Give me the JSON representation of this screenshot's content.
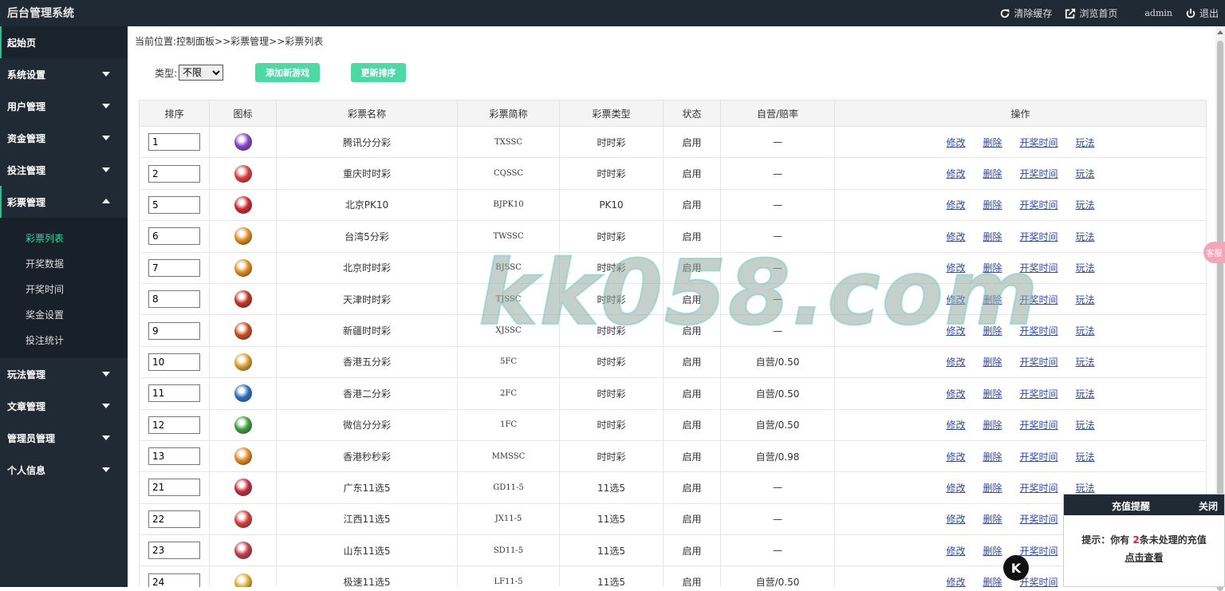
{
  "app": {
    "title": "后台管理系统"
  },
  "topbar": {
    "clear_cache": "清除缓存",
    "browse_home": "浏览首页",
    "user": "admin",
    "logout": "退出"
  },
  "sidebar": {
    "items": [
      {
        "label": "起始页"
      },
      {
        "label": "系统设置"
      },
      {
        "label": "用户管理"
      },
      {
        "label": "资金管理"
      },
      {
        "label": "投注管理"
      },
      {
        "label": "彩票管理"
      },
      {
        "label": "玩法管理"
      },
      {
        "label": "文章管理"
      },
      {
        "label": "管理员管理"
      },
      {
        "label": "个人信息"
      }
    ],
    "submenu": [
      "彩票列表",
      "开奖数据",
      "开奖时间",
      "奖金设置",
      "投注统计"
    ]
  },
  "breadcrumb": "当前位置:控制面板>>彩票管理>>彩票列表",
  "toolbar": {
    "type_label": "类型:",
    "type_value": "不限",
    "add_label": "添加新游戏",
    "sort_label": "更新排序"
  },
  "table": {
    "headers": [
      "排序",
      "图标",
      "彩票名称",
      "彩票简称",
      "彩票类型",
      "状态",
      "自营/赔率",
      "操作"
    ],
    "ops": [
      "修改",
      "删除",
      "开奖时间",
      "玩法"
    ],
    "rows": [
      {
        "order": "1",
        "name": "腾讯分分彩",
        "code": "TXSSC",
        "type": "时时彩",
        "status": "启用",
        "rate": "—",
        "color": "#8a3fd1"
      },
      {
        "order": "2",
        "name": "重庆时时彩",
        "code": "CQSSC",
        "type": "时时彩",
        "status": "启用",
        "rate": "—",
        "color": "#e23a3a"
      },
      {
        "order": "5",
        "name": "北京PK10",
        "code": "BJPK10",
        "type": "PK10",
        "status": "启用",
        "rate": "—",
        "color": "#d6232a"
      },
      {
        "order": "6",
        "name": "台湾5分彩",
        "code": "TWSSC",
        "type": "时时彩",
        "status": "启用",
        "rate": "—",
        "color": "#e88a1a"
      },
      {
        "order": "7",
        "name": "北京时时彩",
        "code": "BJSSC",
        "type": "时时彩",
        "status": "启用",
        "rate": "—",
        "color": "#e88a1a"
      },
      {
        "order": "8",
        "name": "天津时时彩",
        "code": "TJSSC",
        "type": "时时彩",
        "status": "启用",
        "rate": "—",
        "color": "#c8321e"
      },
      {
        "order": "9",
        "name": "新疆时时彩",
        "code": "XJSSC",
        "type": "时时彩",
        "status": "启用",
        "rate": "—",
        "color": "#d14a1e"
      },
      {
        "order": "10",
        "name": "香港五分彩",
        "code": "5FC",
        "type": "时时彩",
        "status": "启用",
        "rate": "自营/0.50",
        "color": "#e0a12a"
      },
      {
        "order": "11",
        "name": "香港二分彩",
        "code": "2FC",
        "type": "时时彩",
        "status": "启用",
        "rate": "自营/0.50",
        "color": "#2a6fc8"
      },
      {
        "order": "12",
        "name": "微信分分彩",
        "code": "1FC",
        "type": "时时彩",
        "status": "启用",
        "rate": "自营/0.50",
        "color": "#3aa13a"
      },
      {
        "order": "13",
        "name": "香港秒秒彩",
        "code": "MMSSC",
        "type": "时时彩",
        "status": "启用",
        "rate": "自营/0.98",
        "color": "#e88a1a"
      },
      {
        "order": "21",
        "name": "广东11选5",
        "code": "GD11-5",
        "type": "11选5",
        "status": "启用",
        "rate": "—",
        "color": "#c82a3a"
      },
      {
        "order": "22",
        "name": "江西11选5",
        "code": "JX11-5",
        "type": "11选5",
        "status": "启用",
        "rate": "—",
        "color": "#d6403a"
      },
      {
        "order": "23",
        "name": "山东11选5",
        "code": "SD11-5",
        "type": "11选5",
        "status": "启用",
        "rate": "—",
        "color": "#c83a4a"
      },
      {
        "order": "24",
        "name": "极速11选5",
        "code": "LF11-5",
        "type": "11选5",
        "status": "启用",
        "rate": "自营/0.50",
        "color": "#e0b02a"
      }
    ]
  },
  "watermark": "kk058.com",
  "side_badge": "客服",
  "popup": {
    "title": "充值提醒",
    "close": "关闭",
    "prefix": "提示：你有",
    "count": "2",
    "suffix": "条未处理的充值",
    "link": "点击查看"
  },
  "float_logo": "K"
}
